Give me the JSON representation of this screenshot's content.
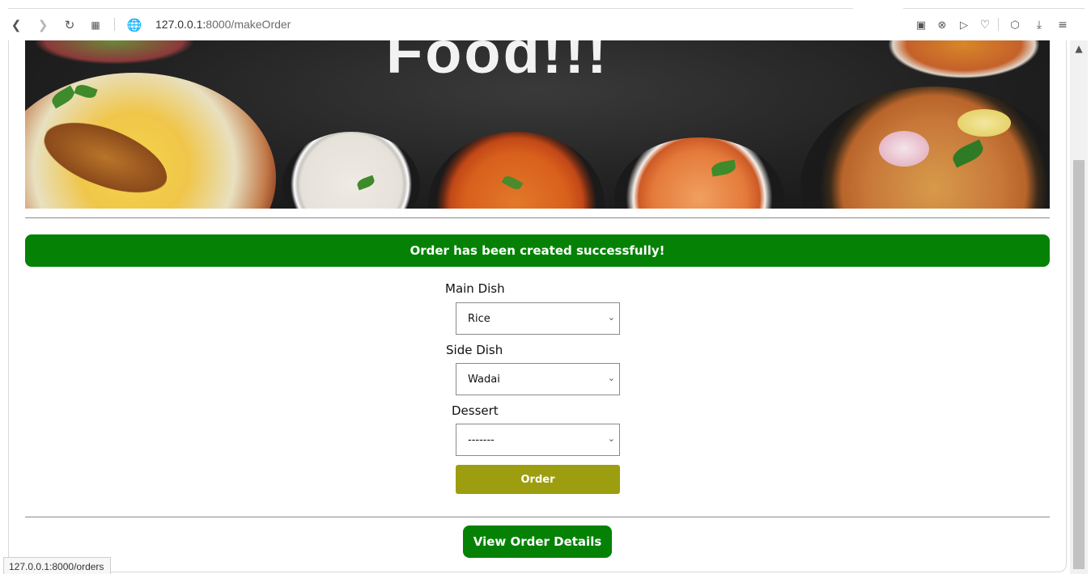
{
  "browser": {
    "url_host": "127.0.0.1:",
    "url_path": "8000/makeOrder",
    "icons": {
      "back": "chevron-left-icon",
      "forward": "chevron-right-icon",
      "reload": "reload-icon",
      "tabs": "tabs-grid-icon",
      "site_info": "globe-icon",
      "screenshot": "camera-icon",
      "block": "shield-x-icon",
      "send": "send-icon",
      "favorite": "heart-icon",
      "extensions": "cube-icon",
      "download": "download-icon",
      "menu": "sliders-icon"
    }
  },
  "banner": {
    "title": "Food!!!"
  },
  "alert": {
    "message": "Order has been created successfully!",
    "color": "#058205"
  },
  "form": {
    "main_dish": {
      "label": "Main Dish",
      "value": "Rice"
    },
    "side_dish": {
      "label": "Side Dish",
      "value": "Wadai"
    },
    "dessert": {
      "label": "Dessert",
      "value": "-------"
    },
    "order_button": "Order",
    "order_button_color": "#9d9d10"
  },
  "view_details_button": "View Order Details",
  "status_bar": "127.0.0.1:8000/orders"
}
